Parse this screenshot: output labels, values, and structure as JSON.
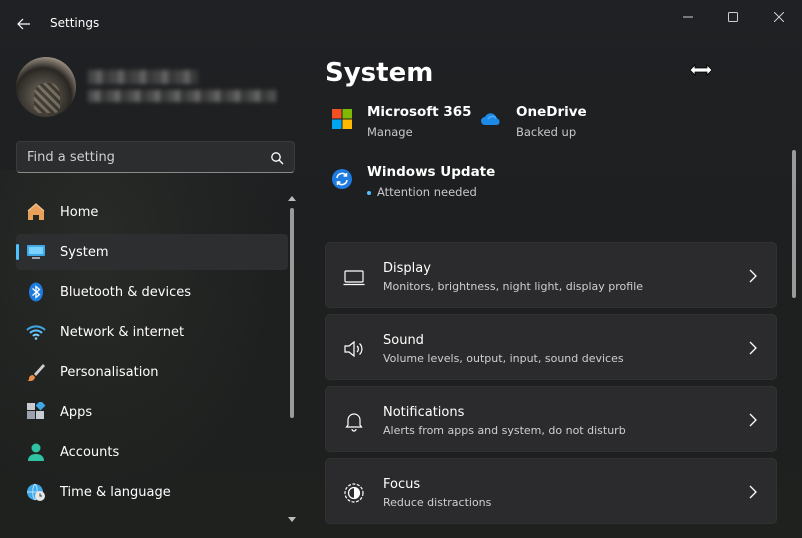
{
  "window": {
    "title": "Settings",
    "controls": [
      "minimize",
      "maximize",
      "close"
    ]
  },
  "search": {
    "placeholder": "Find a setting"
  },
  "sidebar": {
    "items": [
      {
        "label": "Home",
        "icon": "home-icon",
        "active": false
      },
      {
        "label": "System",
        "icon": "system-display-icon",
        "active": true
      },
      {
        "label": "Bluetooth & devices",
        "icon": "bluetooth-icon",
        "active": false
      },
      {
        "label": "Network & internet",
        "icon": "wifi-icon",
        "active": false
      },
      {
        "label": "Personalisation",
        "icon": "brush-icon",
        "active": false
      },
      {
        "label": "Apps",
        "icon": "apps-icon",
        "active": false
      },
      {
        "label": "Accounts",
        "icon": "account-icon",
        "active": false
      },
      {
        "label": "Time & language",
        "icon": "globe-clock-icon",
        "active": false
      }
    ]
  },
  "main": {
    "title": "System",
    "quick_links": [
      {
        "title": "Microsoft 365",
        "subtitle": "Manage",
        "icon": "microsoft-logo-icon"
      },
      {
        "title": "OneDrive",
        "subtitle": "Backed up",
        "icon": "onedrive-cloud-icon"
      },
      {
        "title": "Windows Update",
        "subtitle": "Attention needed",
        "icon": "windows-update-icon"
      }
    ],
    "cards": [
      {
        "title": "Display",
        "subtitle": "Monitors, brightness, night light, display profile",
        "icon": "display-icon"
      },
      {
        "title": "Sound",
        "subtitle": "Volume levels, output, input, sound devices",
        "icon": "speaker-icon"
      },
      {
        "title": "Notifications",
        "subtitle": "Alerts from apps and system, do not disturb",
        "icon": "bell-icon"
      },
      {
        "title": "Focus",
        "subtitle": "Reduce distractions",
        "icon": "focus-icon"
      }
    ]
  },
  "colors": {
    "accent": "#4cc2ff",
    "background": "#202124",
    "card": "#2b2b2d"
  }
}
